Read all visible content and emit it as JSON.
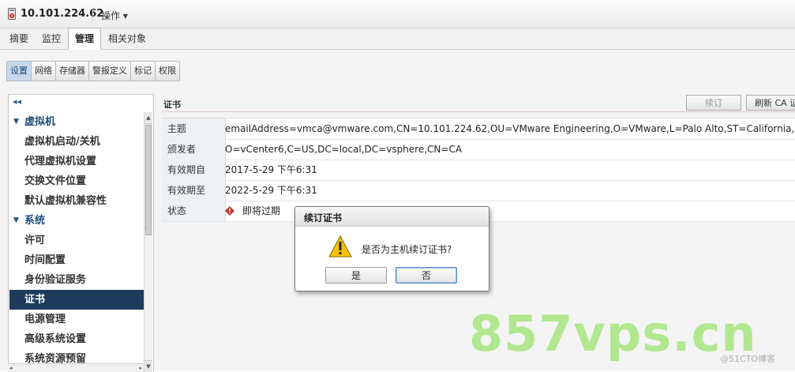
{
  "header": {
    "host": "10.101.224.62",
    "actions_menu": "操作 ▾"
  },
  "tabs": [
    "摘要",
    "监控",
    "管理",
    "相关对象"
  ],
  "active_tab": "管理",
  "subtabs": [
    "设置",
    "网络",
    "存储器",
    "警报定义",
    "标记",
    "权限"
  ],
  "active_subtab": "设置",
  "sidebar": {
    "collapse_glyph": "◂◂",
    "items": [
      {
        "label": "虚拟机",
        "type": "section"
      },
      {
        "label": "虚拟机启动/关机",
        "type": "item"
      },
      {
        "label": "代理虚拟机设置",
        "type": "item"
      },
      {
        "label": "交换文件位置",
        "type": "item"
      },
      {
        "label": "默认虚拟机兼容性",
        "type": "item"
      },
      {
        "label": "系统",
        "type": "section"
      },
      {
        "label": "许可",
        "type": "item"
      },
      {
        "label": "时间配置",
        "type": "item"
      },
      {
        "label": "身份验证服务",
        "type": "item"
      },
      {
        "label": "证书",
        "type": "item",
        "selected": true
      },
      {
        "label": "电源管理",
        "type": "item"
      },
      {
        "label": "高级系统设置",
        "type": "item"
      },
      {
        "label": "系统资源预留",
        "type": "item"
      }
    ]
  },
  "main": {
    "section_title": "证书",
    "renew_button": "续订",
    "refresh_ca_button": "刷新 CA 证",
    "rows": [
      {
        "label": "主题",
        "value": "emailAddress=vmca@vmware.com,CN=10.101.224.62,OU=VMware Engineering,O=VMware,L=Palo Alto,ST=California,C=US"
      },
      {
        "label": "颁发者",
        "value": "O=vCenter6,C=US,DC=local,DC=vsphere,CN=CA"
      },
      {
        "label": "有效期自",
        "value": "2017-5-29 下午6:31"
      },
      {
        "label": "有效期至",
        "value": "2022-5-29 下午6:31"
      },
      {
        "label": "状态",
        "value": "即将过期"
      }
    ]
  },
  "dialog": {
    "title": "续订证书",
    "message": "是否为主机续订证书?",
    "yes": "是",
    "no": "否"
  },
  "watermark": {
    "big": "857vps.cn",
    "small": "@51CTO博客"
  },
  "colors": {
    "selected_bg": "#1f3b5c",
    "section_text": "#1f4e7a",
    "warning_red": "#c0392b",
    "warning_yellow": "#f5c400"
  }
}
